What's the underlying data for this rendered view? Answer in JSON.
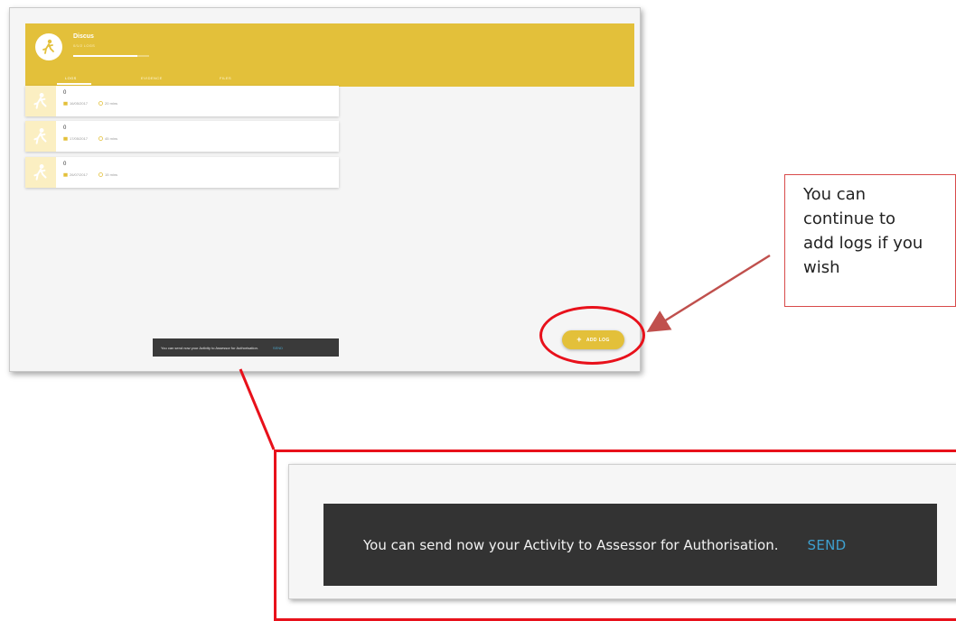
{
  "app": {
    "activity_title": "Discus",
    "activity_subtitle": "0/1/2 LOGS",
    "progress_fraction": 0.85,
    "tabs": [
      {
        "label": "LOGS",
        "active": true
      },
      {
        "label": "EVIDENCE",
        "active": false
      },
      {
        "label": "FILES",
        "active": false
      }
    ],
    "logs": [
      {
        "title": "0",
        "date": "16/05/2017",
        "duration": "20 mins"
      },
      {
        "title": "0",
        "date": "17/05/2017",
        "duration": "45 mins"
      },
      {
        "title": "0",
        "date": "26/07/2017",
        "duration": "15 mins"
      }
    ],
    "snackbar": {
      "message": "You can send now your Activity to Assessor for Authorisation.",
      "action": "SEND"
    },
    "fab": {
      "icon": "plus-icon",
      "label": "ADD LOG"
    }
  },
  "annotation": {
    "callout_text": "You can\ncontinue to\nadd logs if you\nwish"
  },
  "zoom": {
    "message": "You can send now your Activity to Assessor for Authorisation.",
    "action": "SEND"
  },
  "colors": {
    "header_yellow": "#e3c03a",
    "annotation_red": "#e8111b",
    "snackbar_bg": "#333333",
    "send_blue": "#3ea0cf"
  },
  "icons": [
    "athlete-icon",
    "calendar-icon",
    "clock-icon",
    "plus-icon"
  ]
}
